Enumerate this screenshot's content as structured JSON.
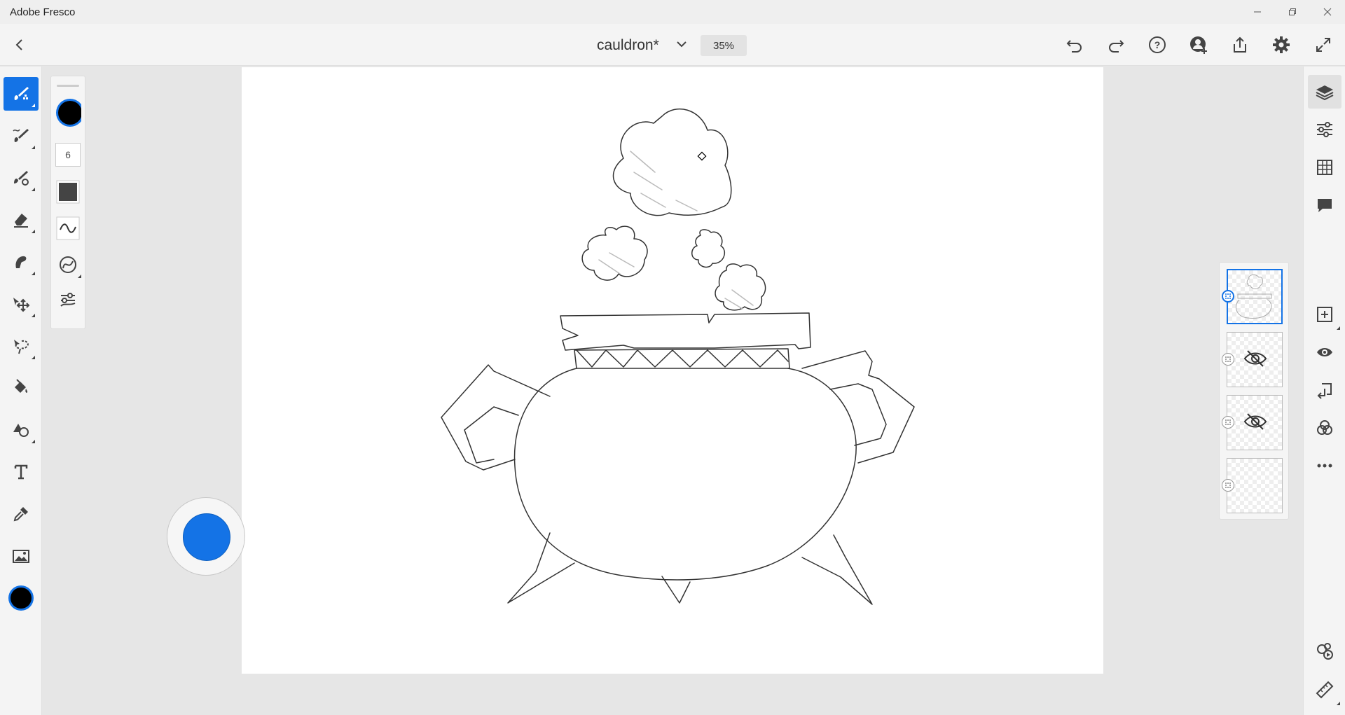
{
  "app": {
    "title": "Adobe Fresco"
  },
  "document": {
    "name": "cauldron*",
    "zoom": "35%"
  },
  "window_controls": [
    "minimize-icon",
    "restore-icon",
    "close-icon"
  ],
  "topbar_right": [
    "undo-icon",
    "redo-icon",
    "help-icon",
    "invite-icon",
    "share-icon",
    "settings-icon",
    "fullscreen-icon"
  ],
  "left_tools": [
    {
      "name": "pixel-brush",
      "active": true
    },
    {
      "name": "live-brush"
    },
    {
      "name": "vector-brush"
    },
    {
      "name": "eraser"
    },
    {
      "name": "smudge"
    },
    {
      "name": "transform"
    },
    {
      "name": "lasso-selection"
    },
    {
      "name": "fill"
    },
    {
      "name": "shapes"
    },
    {
      "name": "type"
    },
    {
      "name": "eyedropper"
    },
    {
      "name": "place-image"
    },
    {
      "name": "color"
    }
  ],
  "brush_properties": {
    "color": "#000000",
    "size": "6",
    "flow_color": "#444444"
  },
  "accent_color": "#1473e6",
  "touch_shortcut_color": "#1473e6",
  "right_tools": [
    "layers-icon",
    "layer-properties-icon",
    "grid-icon",
    "comments-icon",
    "add-layer-icon",
    "visibility-icon",
    "merge-down-icon",
    "blend-mode-icon",
    "more-icon",
    "timeline-icon",
    "ruler-icon"
  ],
  "layers": [
    {
      "selected": true,
      "hidden": false
    },
    {
      "selected": false,
      "hidden": true
    },
    {
      "selected": false,
      "hidden": true
    },
    {
      "selected": false,
      "hidden": false
    }
  ]
}
